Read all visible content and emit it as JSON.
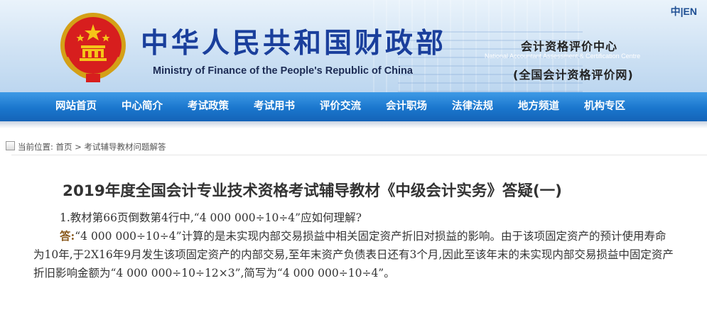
{
  "header": {
    "title_cn": "中华人民共和国财政部",
    "title_en": "Ministry of Finance of the People's Republic of China",
    "lang_cn": "中",
    "lang_sep": "|",
    "lang_en": "EN",
    "center_cn": "会计资格评价中心",
    "center_en": "National Accountant Assessment & Certification Centre",
    "center_net": "(全国会计资格评价网)"
  },
  "nav": {
    "items": [
      "网站首页",
      "中心简介",
      "考试政策",
      "考试用书",
      "评价交流",
      "会计职场",
      "法律法规",
      "地方频道",
      "机构专区"
    ]
  },
  "breadcrumb": {
    "prefix": "当前位置:",
    "home": "首页",
    "sep": " > ",
    "current": "考试辅导教材问题解答"
  },
  "article": {
    "title": "2019年度全国会计专业技术资格考试辅导教材《中级会计实务》答疑(一)",
    "question": "1.教材第66页倒数第4行中,“4 000 000÷10÷4”应如何理解?",
    "answer_label": "答:",
    "answer_text": "“4 000 000÷10÷4”计算的是未实现内部交易损益中相关固定资产折旧对损益的影响。由于该项固定资产的预计使用寿命为10年,于2X16年9月发生该项固定资产的内部交易,至年末资产负债表日还有3个月,因此至该年末的未实现内部交易损益中固定资产折旧影响金额为“4 000 000÷10÷12×3”,简写为“4 000 000÷10÷4”。"
  },
  "colors": {
    "nav_blue": "#1a76cd",
    "title_blue": "#1a3f9c",
    "answer_label": "#8a5a1e"
  }
}
